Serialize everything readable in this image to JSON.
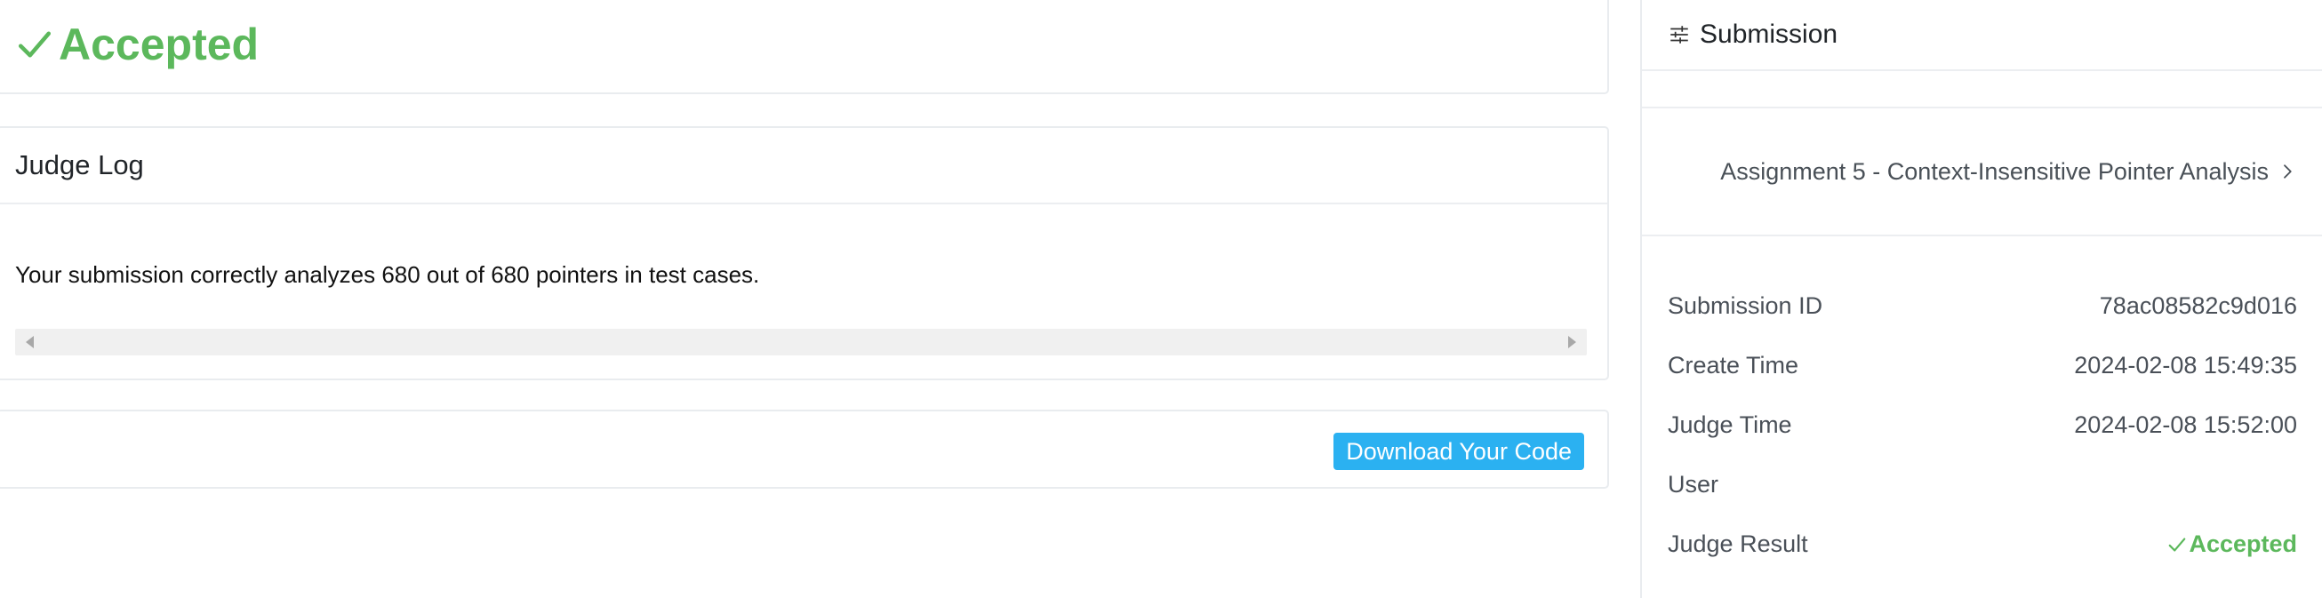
{
  "result": {
    "title": "Accepted",
    "icon": "check-icon",
    "color": "#5cb85c"
  },
  "judge_log": {
    "title": "Judge Log",
    "message": "Your submission correctly analyzes 680 out of 680 pointers in test cases."
  },
  "download": {
    "label": "Download Your Code",
    "color": "#2bb1f1"
  },
  "sidebar": {
    "header": "Submission",
    "header_icon": "sliders-icon",
    "problem_link": "Assignment 5 - Context-Insensitive Pointer Analysis",
    "info": {
      "submission_id": {
        "label": "Submission ID",
        "value": "78ac08582c9d016"
      },
      "create_time": {
        "label": "Create Time",
        "value": "2024-02-08 15:49:35"
      },
      "judge_time": {
        "label": "Judge Time",
        "value": "2024-02-08 15:52:00"
      },
      "user": {
        "label": "User",
        "value": ""
      },
      "judge_result": {
        "label": "Judge Result",
        "value": "Accepted"
      }
    }
  }
}
